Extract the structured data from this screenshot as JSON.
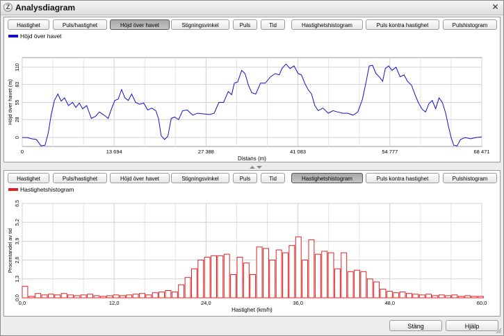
{
  "window": {
    "title": "Analysdiagram",
    "icon": "app-logo-icon",
    "close_glyph": "✕"
  },
  "tabs": [
    "Hastighet",
    "Puls/hastighet",
    "Höjd över havet",
    "Stigningsvinkel",
    "Puls",
    "Tid",
    "Hastighetshistogram",
    "Puls kontra hastighet",
    "Pulshistogram"
  ],
  "top_panel": {
    "active_tab": "Höjd över havet",
    "legend": "Höjd över havet"
  },
  "bottom_panel": {
    "active_tab": "Hastighetshistogram",
    "legend": "Hastighetshistogram"
  },
  "buttons": {
    "close": "Stäng",
    "help": "Hjälp"
  },
  "colors": {
    "line": "#1010c8",
    "bars": "#e02020",
    "active_tab": "#b4b4b4"
  },
  "chart_data": [
    {
      "type": "line",
      "series": [
        {
          "name": "Höjd över havet"
        }
      ],
      "xlabel": "Distans (m)",
      "ylabel": "Höjd över havet (m)",
      "xlim": [
        0,
        68471
      ],
      "ylim": [
        -14,
        125
      ],
      "x_ticks": [
        "0",
        "13 694",
        "27 388",
        "41 083",
        "54 777",
        "68 471"
      ],
      "x_tick_values": [
        0,
        13694,
        27388,
        41083,
        54777,
        68471
      ],
      "y_ticks": [
        "0",
        "28",
        "55",
        "83",
        "110"
      ],
      "y_tick_values": [
        0,
        28,
        55,
        83,
        110
      ],
      "grid": true,
      "points": [
        [
          0,
          0
        ],
        [
          700,
          0
        ],
        [
          1400,
          -2
        ],
        [
          2100,
          -3
        ],
        [
          2800,
          -13
        ],
        [
          3400,
          -12
        ],
        [
          3900,
          8
        ],
        [
          4300,
          35
        ],
        [
          4800,
          58
        ],
        [
          5300,
          68
        ],
        [
          5800,
          57
        ],
        [
          6300,
          62
        ],
        [
          6900,
          50
        ],
        [
          7500,
          55
        ],
        [
          8000,
          47
        ],
        [
          8500,
          54
        ],
        [
          9000,
          45
        ],
        [
          9600,
          50
        ],
        [
          10300,
          30
        ],
        [
          10900,
          33
        ],
        [
          11500,
          40
        ],
        [
          12200,
          35
        ],
        [
          12800,
          30
        ],
        [
          13300,
          45
        ],
        [
          13800,
          58
        ],
        [
          14300,
          60
        ],
        [
          14800,
          75
        ],
        [
          15300,
          62
        ],
        [
          15800,
          58
        ],
        [
          16300,
          68
        ],
        [
          16900,
          55
        ],
        [
          17500,
          52
        ],
        [
          18100,
          54
        ],
        [
          18700,
          43
        ],
        [
          19300,
          46
        ],
        [
          19900,
          42
        ],
        [
          20300,
          30
        ],
        [
          20700,
          3
        ],
        [
          21200,
          -3
        ],
        [
          21700,
          2
        ],
        [
          22200,
          30
        ],
        [
          22700,
          32
        ],
        [
          23300,
          28
        ],
        [
          23900,
          42
        ],
        [
          24600,
          43
        ],
        [
          25400,
          35
        ],
        [
          26100,
          38
        ],
        [
          27000,
          37
        ],
        [
          27900,
          36
        ],
        [
          28600,
          38
        ],
        [
          29300,
          55
        ],
        [
          30000,
          55
        ],
        [
          30700,
          72
        ],
        [
          31200,
          67
        ],
        [
          31600,
          85
        ],
        [
          32100,
          87
        ],
        [
          32700,
          105
        ],
        [
          33200,
          100
        ],
        [
          33700,
          82
        ],
        [
          34200,
          70
        ],
        [
          34800,
          68
        ],
        [
          35500,
          85
        ],
        [
          36200,
          85
        ],
        [
          37000,
          95
        ],
        [
          37700,
          100
        ],
        [
          38300,
          98
        ],
        [
          38700,
          108
        ],
        [
          39300,
          115
        ],
        [
          39900,
          108
        ],
        [
          40500,
          112
        ],
        [
          41100,
          100
        ],
        [
          41600,
          98
        ],
        [
          42100,
          85
        ],
        [
          42600,
          75
        ],
        [
          43100,
          68
        ],
        [
          43600,
          50
        ],
        [
          44100,
          42
        ],
        [
          44800,
          46
        ],
        [
          45600,
          38
        ],
        [
          46300,
          42
        ],
        [
          47000,
          40
        ],
        [
          47800,
          38
        ],
        [
          48500,
          38
        ],
        [
          49300,
          35
        ],
        [
          50000,
          40
        ],
        [
          50700,
          60
        ],
        [
          51300,
          90
        ],
        [
          51700,
          112
        ],
        [
          52200,
          113
        ],
        [
          52700,
          100
        ],
        [
          53200,
          95
        ],
        [
          53700,
          88
        ],
        [
          54100,
          108
        ],
        [
          54600,
          112
        ],
        [
          55100,
          105
        ],
        [
          55700,
          110
        ],
        [
          56300,
          95
        ],
        [
          56900,
          98
        ],
        [
          57400,
          88
        ],
        [
          58000,
          82
        ],
        [
          58500,
          68
        ],
        [
          59000,
          55
        ],
        [
          59600,
          44
        ],
        [
          60100,
          40
        ],
        [
          60600,
          53
        ],
        [
          61100,
          58
        ],
        [
          61600,
          45
        ],
        [
          62100,
          62
        ],
        [
          62600,
          55
        ],
        [
          63100,
          38
        ],
        [
          63500,
          18
        ],
        [
          63900,
          0
        ],
        [
          64300,
          -12
        ],
        [
          64800,
          -13
        ],
        [
          65300,
          -3
        ],
        [
          66000,
          0
        ],
        [
          66800,
          -2
        ],
        [
          67600,
          0
        ],
        [
          68471,
          1
        ]
      ]
    },
    {
      "type": "bar",
      "series": [
        {
          "name": "Hastighetshistogram"
        }
      ],
      "xlabel": "Hastighet (km/h)",
      "ylabel": "Procentandel av tid",
      "xlim": [
        0,
        60
      ],
      "ylim": [
        0,
        6.5
      ],
      "x_ticks": [
        "0,0",
        "12,0",
        "24,0",
        "36,0",
        "48,0",
        "60,0"
      ],
      "x_tick_values": [
        0,
        12,
        24,
        36,
        48,
        60
      ],
      "y_ticks": [
        "0,0",
        "1,3",
        "2,6",
        "3,9",
        "5,2",
        "6,5"
      ],
      "y_tick_values": [
        0,
        1.3,
        2.6,
        3.9,
        5.2,
        6.5
      ],
      "grid": true,
      "bar_width": 0.72,
      "x": [
        0,
        0.85,
        1.7,
        2.55,
        3.4,
        4.25,
        5.1,
        5.95,
        6.8,
        7.65,
        8.5,
        9.35,
        10.2,
        11.05,
        11.9,
        12.75,
        13.6,
        14.45,
        15.3,
        16.15,
        17.0,
        17.85,
        18.7,
        19.55,
        20.4,
        21.25,
        22.1,
        22.95,
        23.8,
        24.65,
        25.5,
        26.35,
        27.2,
        28.05,
        28.9,
        29.75,
        30.6,
        31.45,
        32.3,
        33.15,
        34.0,
        34.85,
        35.7,
        36.55,
        37.4,
        38.25,
        39.1,
        39.95,
        40.8,
        41.65,
        42.5,
        43.35,
        44.2,
        45.05,
        45.9,
        46.75,
        47.6,
        48.45,
        49.3,
        50.15,
        51.0,
        51.85,
        52.7,
        53.55,
        54.4,
        55.25,
        56.1,
        56.95,
        57.8,
        58.65,
        59.5
      ],
      "values": [
        0.8,
        0.1,
        0.3,
        0.2,
        0.25,
        0.2,
        0.3,
        0.2,
        0.15,
        0.2,
        0.25,
        0.15,
        0.1,
        0.15,
        0.2,
        0.15,
        0.2,
        0.25,
        0.3,
        0.2,
        0.35,
        0.4,
        0.5,
        0.4,
        0.9,
        1.4,
        2.0,
        2.6,
        2.8,
        2.9,
        2.9,
        3.0,
        1.6,
        2.8,
        2.4,
        1.6,
        3.5,
        3.4,
        2.6,
        3.3,
        3.1,
        3.6,
        4.2,
        2.6,
        4.0,
        3.0,
        3.2,
        3.1,
        2.0,
        3.1,
        1.8,
        1.9,
        1.8,
        1.3,
        1.1,
        0.6,
        0.45,
        0.35,
        0.4,
        0.3,
        0.25,
        0.2,
        0.25,
        0.15,
        0.2,
        0.15,
        0.2,
        0.1,
        0.15,
        0.1,
        0.1
      ]
    }
  ]
}
